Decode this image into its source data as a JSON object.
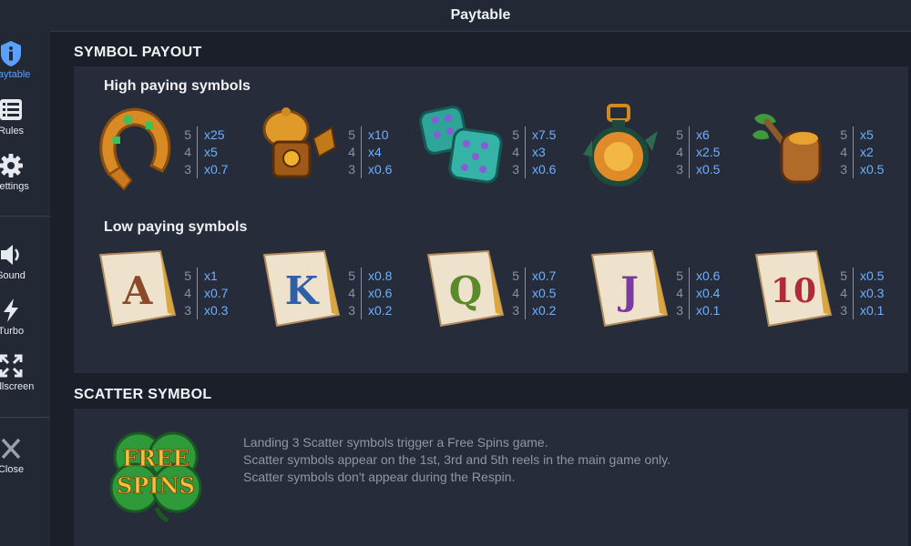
{
  "sidebar": {
    "items": [
      {
        "label": "Paytable",
        "icon": "info-icon",
        "active": true
      },
      {
        "label": "Rules",
        "icon": "list-icon",
        "active": false
      },
      {
        "label": "Settings",
        "icon": "gear-icon",
        "active": false
      },
      {
        "label": "Sound",
        "icon": "speaker-icon",
        "active": false
      },
      {
        "label": "Turbo",
        "icon": "lightning-icon",
        "active": false
      },
      {
        "label": "Fullscreen",
        "icon": "fullscreen-icon",
        "active": false
      },
      {
        "label": "Close",
        "icon": "close-icon",
        "active": false
      }
    ]
  },
  "header": {
    "title": "Paytable"
  },
  "symbol_payout": {
    "title": "SYMBOL PAYOUT",
    "high": {
      "title": "High paying symbols",
      "symbols": [
        {
          "name": "horseshoe",
          "payouts": [
            {
              "count": "5",
              "mult": "x25"
            },
            {
              "count": "4",
              "mult": "x5"
            },
            {
              "count": "3",
              "mult": "x0.7"
            }
          ]
        },
        {
          "name": "lantern-helmet",
          "payouts": [
            {
              "count": "5",
              "mult": "x10"
            },
            {
              "count": "4",
              "mult": "x4"
            },
            {
              "count": "3",
              "mult": "x0.6"
            }
          ]
        },
        {
          "name": "dice",
          "payouts": [
            {
              "count": "5",
              "mult": "x7.5"
            },
            {
              "count": "4",
              "mult": "x3"
            },
            {
              "count": "3",
              "mult": "x0.6"
            }
          ]
        },
        {
          "name": "potion",
          "payouts": [
            {
              "count": "5",
              "mult": "x6"
            },
            {
              "count": "4",
              "mult": "x2.5"
            },
            {
              "count": "3",
              "mult": "x0.5"
            }
          ]
        },
        {
          "name": "pipe",
          "payouts": [
            {
              "count": "5",
              "mult": "x5"
            },
            {
              "count": "4",
              "mult": "x2"
            },
            {
              "count": "3",
              "mult": "x0.5"
            }
          ]
        }
      ]
    },
    "low": {
      "title": "Low paying symbols",
      "symbols": [
        {
          "letter": "A",
          "color": "#8a4a2a",
          "payouts": [
            {
              "count": "5",
              "mult": "x1"
            },
            {
              "count": "4",
              "mult": "x0.7"
            },
            {
              "count": "3",
              "mult": "x0.3"
            }
          ]
        },
        {
          "letter": "K",
          "color": "#2f5fa8",
          "payouts": [
            {
              "count": "5",
              "mult": "x0.8"
            },
            {
              "count": "4",
              "mult": "x0.6"
            },
            {
              "count": "3",
              "mult": "x0.2"
            }
          ]
        },
        {
          "letter": "Q",
          "color": "#5b8a2a",
          "payouts": [
            {
              "count": "5",
              "mult": "x0.7"
            },
            {
              "count": "4",
              "mult": "x0.5"
            },
            {
              "count": "3",
              "mult": "x0.2"
            }
          ]
        },
        {
          "letter": "J",
          "color": "#7b3aa0",
          "payouts": [
            {
              "count": "5",
              "mult": "x0.6"
            },
            {
              "count": "4",
              "mult": "x0.4"
            },
            {
              "count": "3",
              "mult": "x0.1"
            }
          ]
        },
        {
          "letter": "10",
          "color": "#b02a3a",
          "payouts": [
            {
              "count": "5",
              "mult": "x0.5"
            },
            {
              "count": "4",
              "mult": "x0.3"
            },
            {
              "count": "3",
              "mult": "x0.1"
            }
          ]
        }
      ]
    }
  },
  "scatter": {
    "title": "SCATTER SYMBOL",
    "logo_line1": "FREE",
    "logo_line2": "SPINS",
    "lines": [
      "Landing 3 Scatter symbols trigger a Free Spins game.",
      "Scatter symbols appear on the 1st, 3rd and 5th reels in the main game only.",
      "Scatter symbols don't appear during the Respin."
    ]
  },
  "colors": {
    "accent": "#5aa0ff",
    "multiplier": "#6fb0ff",
    "panel": "#262c39",
    "background": "#1b1f29"
  }
}
